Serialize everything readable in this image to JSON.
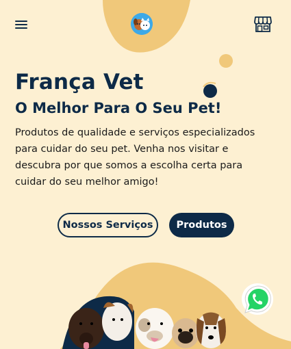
{
  "header": {
    "menu_icon": "hamburger-menu-icon",
    "logo_icon": "pet-logo-icon",
    "store_icon": "storefront-icon"
  },
  "hero": {
    "title": "França Vet",
    "subtitle": "O Melhor Para O Seu Pet!",
    "description": "Produtos de qualidade e serviços especializados para cuidar do seu pet. Venha nos visitar e descubra por que somos a escolha certa para cuidar do seu melhor amigo!",
    "services_button": "Nossos Serviços",
    "products_button": "Produtos"
  },
  "floating": {
    "whatsapp_icon": "whatsapp-icon"
  },
  "colors": {
    "background": "#fdf0d2",
    "accent_shape": "#f0c87a",
    "primary": "#0d2a47",
    "whatsapp_green": "#25d366"
  }
}
